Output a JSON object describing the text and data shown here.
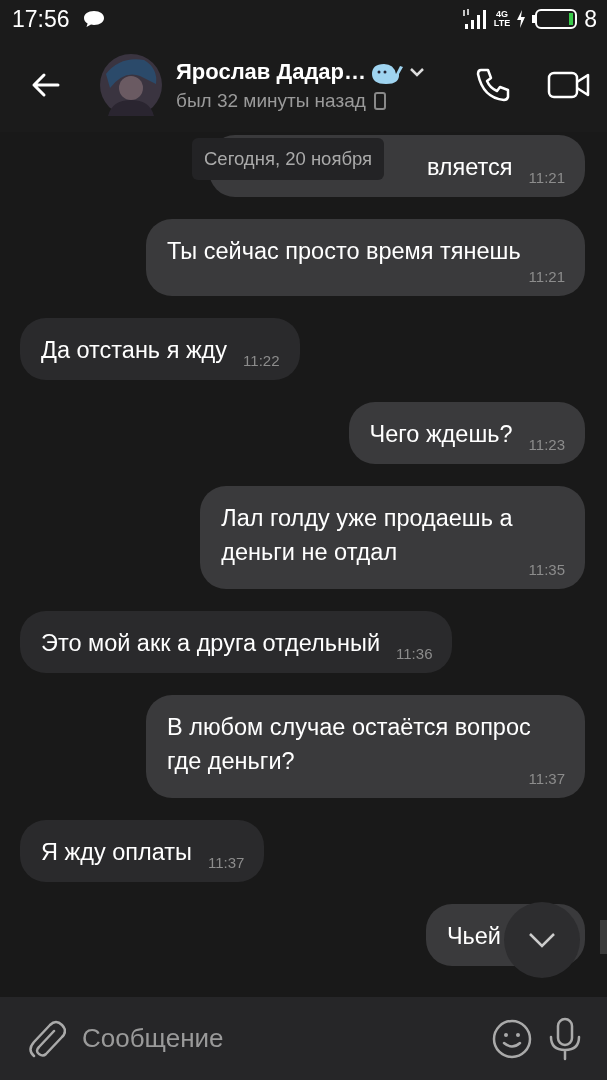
{
  "status_bar": {
    "time": "17:56",
    "network": [
      "4G",
      "LTE"
    ],
    "battery": "8"
  },
  "header": {
    "name": "Ярослав Дадар…",
    "status": "был 32 минуты назад"
  },
  "date_label": "Сегодня, 20 ноября",
  "messages": [
    {
      "outgoing": true,
      "text": "вляется",
      "time": "11:21"
    },
    {
      "outgoing": true,
      "text": "Ты сейчас просто время тянешь",
      "time": "11:21"
    },
    {
      "outgoing": false,
      "text": "Да отстань я жду",
      "time": "11:22"
    },
    {
      "outgoing": true,
      "text": "Чего ждешь?",
      "time": "11:23"
    },
    {
      "outgoing": true,
      "text": "Лал голду уже продаешь а\nденьги не отдал",
      "time": "11:35"
    },
    {
      "outgoing": false,
      "text": "Это мой акк а друга отдельный",
      "time": "11:36"
    },
    {
      "outgoing": true,
      "text": "В любом случае остаётся вопрос\nгде деньги?",
      "time": "11:37"
    },
    {
      "outgoing": false,
      "text": "Я жду оплаты",
      "time": "11:37"
    },
    {
      "outgoing": true,
      "text": "Чьей"
    }
  ],
  "composer": {
    "placeholder": "Сообщение"
  }
}
